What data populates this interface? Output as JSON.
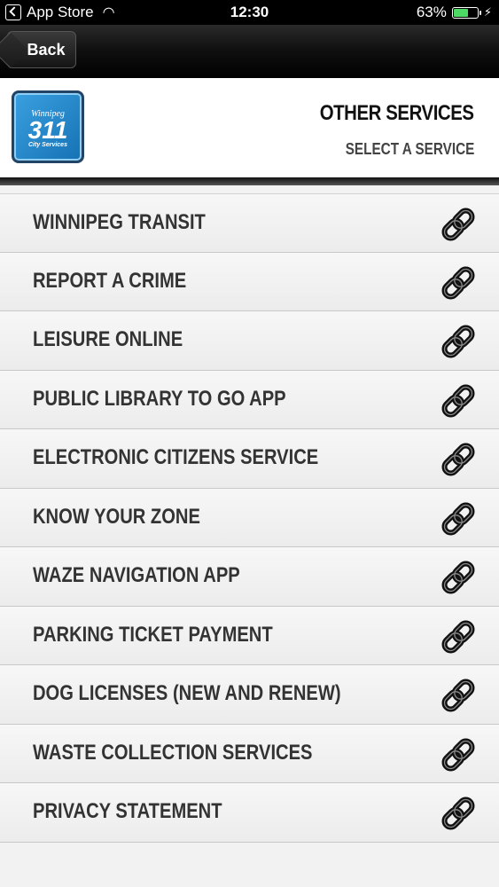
{
  "status_bar": {
    "back_app": "App Store",
    "time": "12:30",
    "battery": "63%",
    "battery_level": 0.63
  },
  "nav": {
    "back_label": "Back"
  },
  "header": {
    "logo": {
      "city": "Winnipeg",
      "number": "311",
      "subtitle": "City Services"
    },
    "title": "OTHER SERVICES",
    "subtitle": "SELECT A SERVICE"
  },
  "services": [
    {
      "label": "WINNIPEG TRANSIT",
      "icon": "link-icon"
    },
    {
      "label": "REPORT A CRIME",
      "icon": "link-icon"
    },
    {
      "label": "LEISURE ONLINE",
      "icon": "link-icon"
    },
    {
      "label": "PUBLIC LIBRARY TO GO APP",
      "icon": "link-icon"
    },
    {
      "label": "ELECTRONIC CITIZENS SERVICE",
      "icon": "link-icon"
    },
    {
      "label": "KNOW YOUR ZONE",
      "icon": "link-icon"
    },
    {
      "label": "WAZE NAVIGATION APP",
      "icon": "link-icon"
    },
    {
      "label": "PARKING TICKET PAYMENT",
      "icon": "link-icon"
    },
    {
      "label": "DOG LICENSES (NEW AND RENEW)",
      "icon": "link-icon"
    },
    {
      "label": "WASTE COLLECTION SERVICES",
      "icon": "link-icon"
    },
    {
      "label": "PRIVACY STATEMENT",
      "icon": "link-icon"
    }
  ]
}
